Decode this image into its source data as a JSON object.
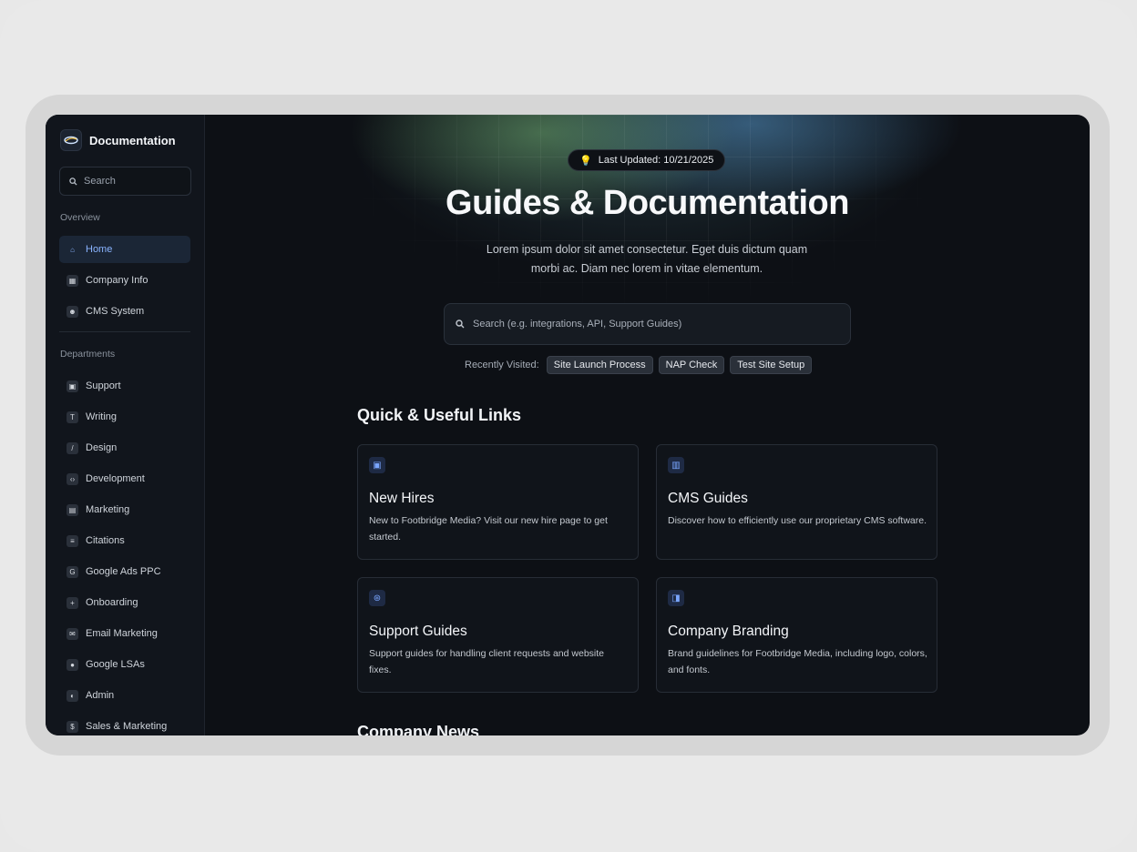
{
  "sidebar": {
    "brand_title": "Documentation",
    "search_placeholder": "Search",
    "overview_label": "Overview",
    "overview_items": [
      {
        "label": "Home",
        "icon": "home-icon",
        "active": true
      },
      {
        "label": "Company Info",
        "icon": "building-icon"
      },
      {
        "label": "CMS System",
        "icon": "users-icon"
      }
    ],
    "departments_label": "Departments",
    "department_items": [
      {
        "label": "Support",
        "icon": "support-icon"
      },
      {
        "label": "Writing",
        "icon": "text-icon"
      },
      {
        "label": "Design",
        "icon": "brush-icon"
      },
      {
        "label": "Development",
        "icon": "code-icon"
      },
      {
        "label": "Marketing",
        "icon": "id-card-icon"
      },
      {
        "label": "Citations",
        "icon": "document-icon"
      },
      {
        "label": "Google Ads PPC",
        "icon": "google-icon"
      },
      {
        "label": "Onboarding",
        "icon": "person-add-icon"
      },
      {
        "label": "Email Marketing",
        "icon": "mail-icon"
      },
      {
        "label": "Google LSAs",
        "icon": "location-pin-icon"
      },
      {
        "label": "Admin",
        "icon": "admin-icon"
      },
      {
        "label": "Sales & Marketing",
        "icon": "dollar-icon"
      }
    ]
  },
  "hero": {
    "badge_text": "Last Updated: 10/21/2025",
    "title": "Guides & Documentation",
    "subtitle": "Lorem ipsum dolor sit amet consectetur. Eget duis dictum quam morbi ac. Diam nec lorem in vitae elementum.",
    "search_placeholder": "Search (e.g. integrations, API, Support Guides)",
    "recent_label": "Recently Visited:",
    "recent_chips": [
      "Site Launch Process",
      "NAP Check",
      "Test Site Setup"
    ]
  },
  "quick_links": {
    "title": "Quick & Useful Links",
    "cards": [
      {
        "title": "New Hires",
        "desc": "New to Footbridge Media? Visit our new hire page to get started.",
        "icon": "badge-icon"
      },
      {
        "title": "CMS Guides",
        "desc": "Discover how to efficiently use our proprietary CMS software.",
        "icon": "dashboard-icon"
      },
      {
        "title": "Support Guides",
        "desc": "Support guides for handling client requests and website fixes.",
        "icon": "lifebuoy-icon"
      },
      {
        "title": "Company Branding",
        "desc": "Brand guidelines for Footbridge Media, including logo, colors, and fonts.",
        "icon": "brand-window-icon"
      }
    ]
  },
  "news": {
    "title": "Company News"
  },
  "colors": {
    "accent": "#8ab4ff",
    "background": "#0d1015",
    "sidebar": "#11151c"
  }
}
